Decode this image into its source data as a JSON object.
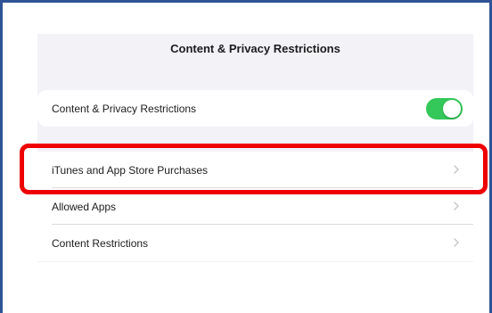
{
  "header": {
    "title": "Content & Privacy Restrictions"
  },
  "settings": {
    "master_toggle": {
      "label": "Content & Privacy Restrictions",
      "state": "on",
      "color": "#34c759"
    },
    "items": [
      {
        "label": "iTunes and App Store Purchases",
        "icon": "chevron-right-icon"
      },
      {
        "label": "Allowed Apps",
        "icon": "chevron-right-icon"
      },
      {
        "label": "Content Restrictions",
        "icon": "chevron-right-icon"
      }
    ]
  },
  "annotation": {
    "highlight_color": "#ee0000",
    "target": "iTunes and App Store Purchases"
  },
  "frame_color": "#2f5496"
}
